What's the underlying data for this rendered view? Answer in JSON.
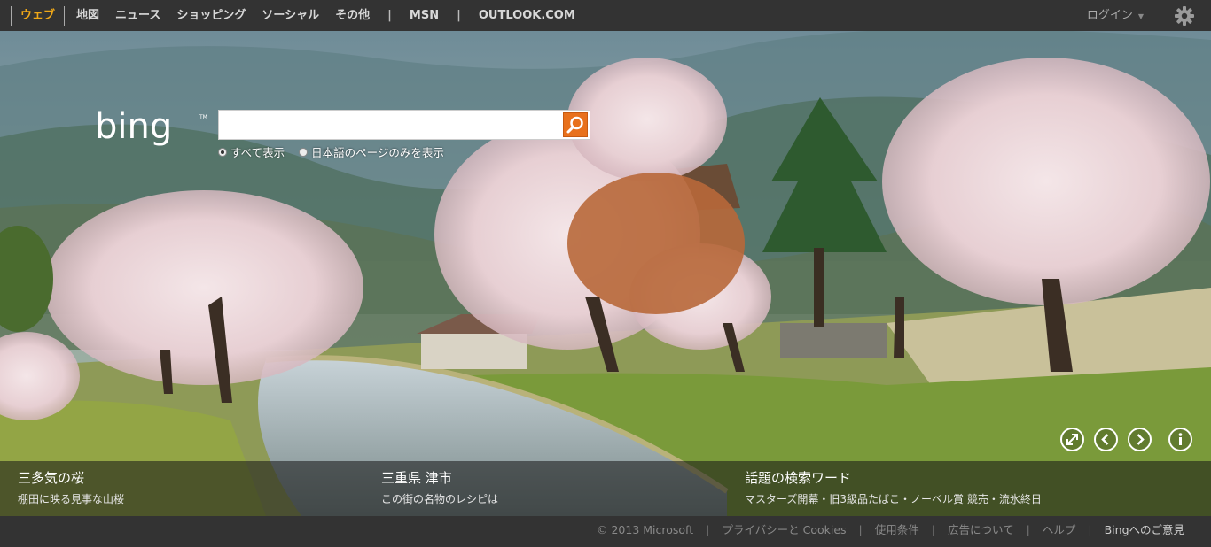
{
  "nav": {
    "items": [
      "ウェブ",
      "地図",
      "ニュース",
      "ショッピング",
      "ソーシャル",
      "その他"
    ],
    "sep": "|",
    "msn": "MSN",
    "outlook": "OUTLOOK.COM",
    "login": "ログイン",
    "caret": "▼"
  },
  "search": {
    "value": "",
    "scope_all": "すべて表示",
    "scope_ja": "日本語のページのみを表示"
  },
  "hotspots": [
    {
      "title": "三多気の桜",
      "subtitle": "棚田に映る見事な山桜"
    },
    {
      "title": "三重県 津市",
      "subtitle": "この街の名物のレシピは"
    },
    {
      "title": "話題の検索ワード",
      "subtitle": "マスターズ開幕・旧3級品たばこ・ノーベル賞 競売・流氷終日"
    }
  ],
  "footer": {
    "copyright": "© 2013 Microsoft",
    "privacy": "プライバシーと Cookies",
    "terms": "使用条件",
    "ads": "広告について",
    "help": "ヘルプ",
    "feedback": "Bingへのご意見",
    "sep": "|"
  },
  "colors": {
    "accent": "#f0a818",
    "search_button": "#e8711c",
    "bar": "#333333"
  },
  "icons": [
    "gear-icon",
    "search-icon",
    "fullscreen-icon",
    "prev-icon",
    "next-icon",
    "info-icon",
    "bing-logo"
  ]
}
